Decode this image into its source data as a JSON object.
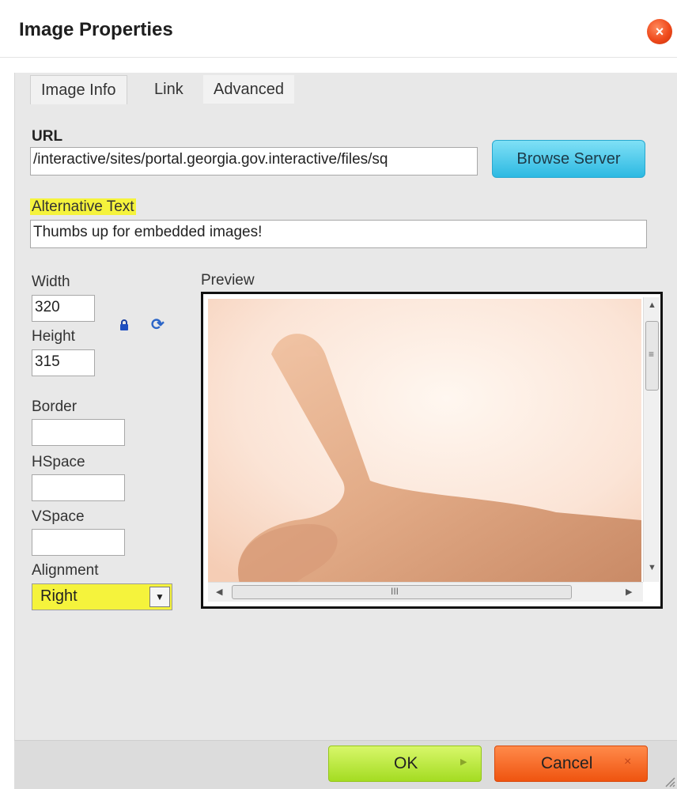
{
  "dialog": {
    "title": "Image Properties",
    "close_icon": "close-icon"
  },
  "tabs": [
    {
      "label": "Image Info",
      "active": true
    },
    {
      "label": "Link",
      "active": false
    },
    {
      "label": "Advanced",
      "active": false
    }
  ],
  "url_field": {
    "label": "URL",
    "value": "/interactive/sites/portal.georgia.gov.interactive/files/sq"
  },
  "browse_button": "Browse Server",
  "alt_text": {
    "label": "Alternative Text",
    "value": "Thumbs up for embedded images!"
  },
  "dimensions": {
    "width_label": "Width",
    "width_value": "320",
    "height_label": "Height",
    "height_value": "315",
    "lock_icon": "lock-icon",
    "reset_icon": "reset-size-icon"
  },
  "border": {
    "label": "Border",
    "value": ""
  },
  "hspace": {
    "label": "HSpace",
    "value": ""
  },
  "vspace": {
    "label": "VSpace",
    "value": ""
  },
  "alignment": {
    "label": "Alignment",
    "value": "Right"
  },
  "preview": {
    "label": "Preview",
    "scroll_grip": "≡",
    "hscroll_grip": "III"
  },
  "footer": {
    "ok_label": "OK",
    "cancel_label": "Cancel"
  },
  "colors": {
    "highlight": "#f5f33c",
    "ok": "#a4dc22",
    "cancel": "#ef5410",
    "browse": "#2cb9e2"
  }
}
